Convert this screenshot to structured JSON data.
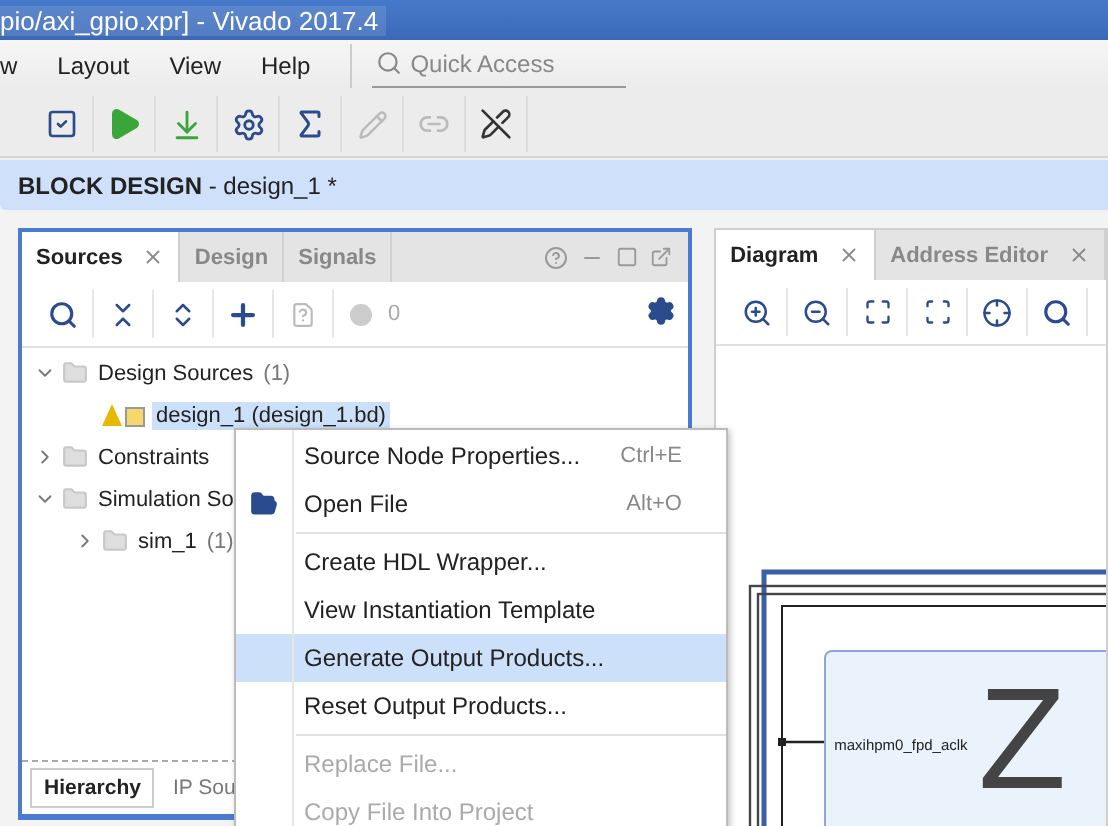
{
  "window": {
    "title": "pio/axi_gpio.xpr] - Vivado 2017.4"
  },
  "menu_bar": {
    "items": [
      {
        "label": "w"
      },
      {
        "label": "Layout"
      },
      {
        "label": "View"
      },
      {
        "label": "Help"
      }
    ],
    "quick_access": {
      "placeholder": "Quick Access"
    }
  },
  "toolbar": {
    "buttons": [
      {
        "kind": "check",
        "disabled": false
      },
      {
        "kind": "run",
        "disabled": false
      },
      {
        "kind": "program",
        "disabled": false
      },
      {
        "kind": "settings",
        "disabled": false
      },
      {
        "kind": "sigma",
        "disabled": false
      },
      {
        "kind": "pencil",
        "disabled": true
      },
      {
        "kind": "link",
        "disabled": true
      },
      {
        "kind": "pen-off",
        "disabled": false
      }
    ]
  },
  "block_design": {
    "title": "BLOCK DESIGN",
    "name": " - design_1 *"
  },
  "sources_panel": {
    "tabs": [
      {
        "label": "Sources",
        "selected": true
      },
      {
        "label": "Design",
        "selected": false
      },
      {
        "label": "Signals",
        "selected": false
      }
    ],
    "message_count": "0",
    "tree": [
      {
        "label": "Design Sources",
        "count": "(1)",
        "expanded": true,
        "children": [
          {
            "label": "design_1 (design_1.bd)",
            "selected": true
          }
        ]
      },
      {
        "label": "Constraints",
        "expanded": false
      },
      {
        "label": "Simulation So",
        "expanded": true,
        "children": [
          {
            "label": "sim_1",
            "count": "(1)",
            "expanded": false
          }
        ]
      }
    ],
    "bottom_tabs": [
      {
        "label": "Hierarchy",
        "selected": true
      },
      {
        "label": "IP Sou",
        "selected": false
      }
    ]
  },
  "context_menu": {
    "items": [
      {
        "kind": "item",
        "label": "Source Node Properties...",
        "shortcut": "Ctrl+E",
        "selected": false,
        "disabled": false
      },
      {
        "kind": "item",
        "label": "Open File",
        "shortcut": "Alt+O",
        "has_icon": true,
        "selected": false,
        "disabled": false
      },
      {
        "kind": "separator"
      },
      {
        "kind": "item",
        "label": "Create HDL Wrapper...",
        "selected": false,
        "disabled": false
      },
      {
        "kind": "item",
        "label": "View Instantiation Template",
        "selected": false,
        "disabled": false
      },
      {
        "kind": "item",
        "label": "Generate Output Products...",
        "selected": true,
        "disabled": false
      },
      {
        "kind": "item",
        "label": "Reset Output Products...",
        "selected": false,
        "disabled": false
      },
      {
        "kind": "separator"
      },
      {
        "kind": "item",
        "label": "Replace File...",
        "selected": false,
        "disabled": true
      },
      {
        "kind": "item",
        "label": "Copy File Into Project",
        "selected": false,
        "disabled": true
      }
    ]
  },
  "diagram_panel": {
    "tabs": [
      {
        "label": "Diagram",
        "selected": true
      },
      {
        "label": "Address Editor",
        "selected": false
      }
    ],
    "block": {
      "port": "maxihpm0_fpd_aclk",
      "title": "Z"
    }
  }
}
